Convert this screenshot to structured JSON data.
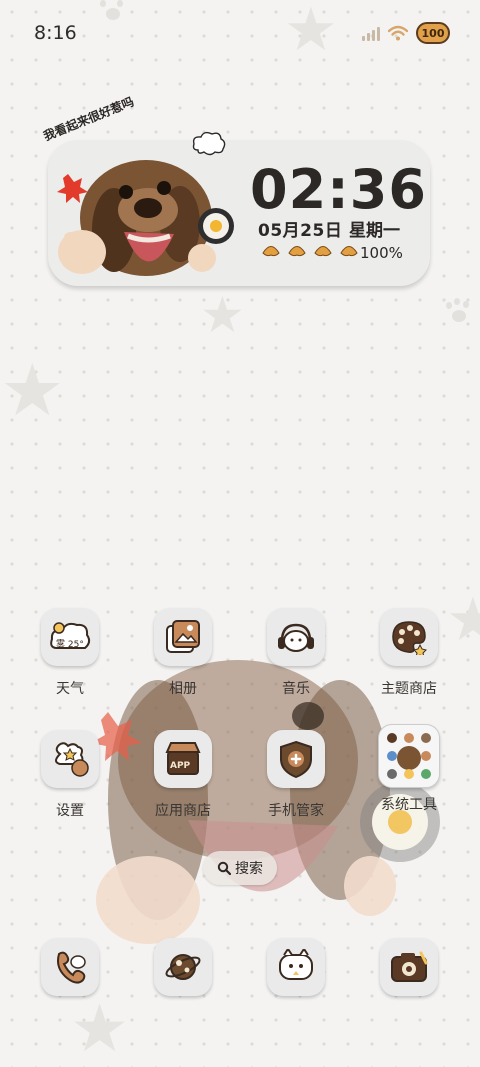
{
  "status_bar": {
    "time": "8:16",
    "battery_label": "100",
    "icons": [
      "signal-icon",
      "wifi-icon",
      "battery-icon"
    ]
  },
  "widget": {
    "sticker_text": "我看起来很好惹吗",
    "time": "02:36",
    "date": "05月25日",
    "weekday": "星期一",
    "battery_percent": "100%"
  },
  "apps": [
    {
      "label": "天气",
      "icon": "weather-icon",
      "badge": "雾 25°"
    },
    {
      "label": "相册",
      "icon": "gallery-icon"
    },
    {
      "label": "音乐",
      "icon": "music-icon"
    },
    {
      "label": "主题商店",
      "icon": "theme-store-icon"
    },
    {
      "label": "设置",
      "icon": "settings-icon"
    },
    {
      "label": "应用商店",
      "icon": "app-store-icon",
      "badge": "APP"
    },
    {
      "label": "手机管家",
      "icon": "phone-manager-icon"
    },
    {
      "label": "系统工具",
      "icon": "system-tools-folder-icon"
    }
  ],
  "search": {
    "label": "搜索"
  },
  "dock": [
    {
      "icon": "phone-icon"
    },
    {
      "icon": "browser-icon"
    },
    {
      "icon": "messages-icon"
    },
    {
      "icon": "camera-icon"
    }
  ],
  "colors": {
    "accent_brown": "#6b4a2e",
    "tile_bg": "#eaeaea",
    "battery_orange": "#e1a04a"
  }
}
